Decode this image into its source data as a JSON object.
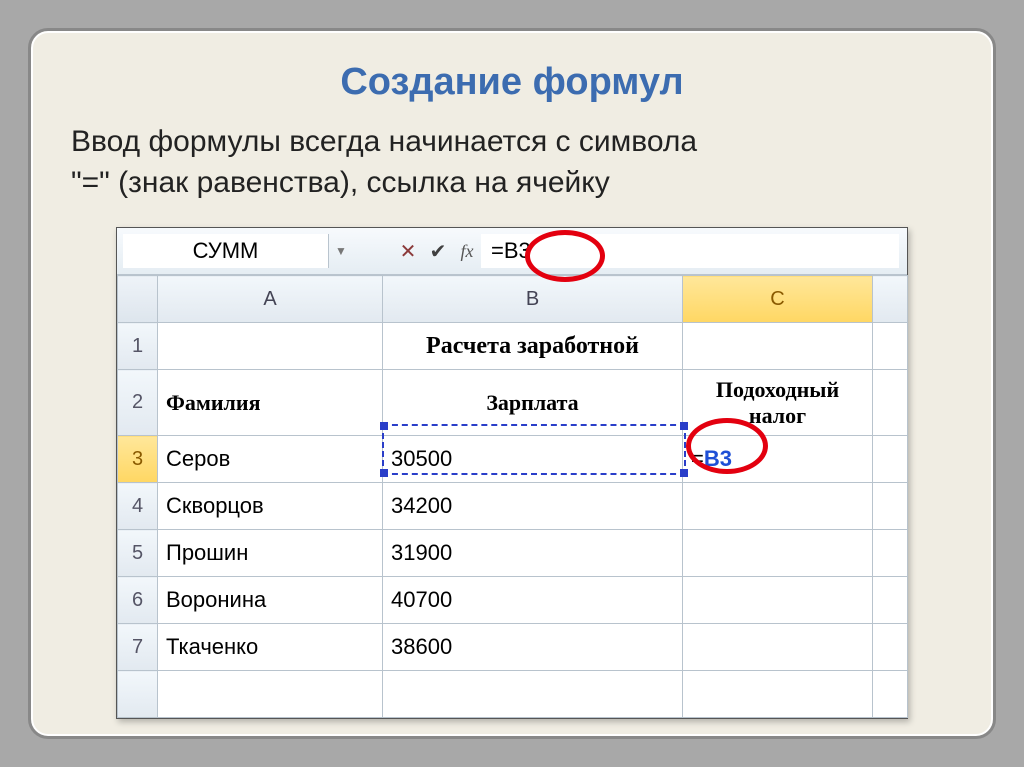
{
  "slide": {
    "title": "Создание формул",
    "text_line1": "Ввод формулы всегда начинается с символа",
    "text_line2": "\"=\" (знак равенства), ссылка на ячейку"
  },
  "formula_bar": {
    "name_box": "СУММ",
    "fx_label": "fx",
    "formula_value": "=B3"
  },
  "columns": {
    "A": "A",
    "B": "B",
    "C": "C"
  },
  "row_headers": [
    "1",
    "2",
    "3",
    "4",
    "5",
    "6",
    "7"
  ],
  "cells": {
    "B1": "Расчета заработной",
    "A2": "Фамилия",
    "B2": "Зарплата",
    "C2_line1": "Подоходный",
    "C2_line2": "налог",
    "A3": "Серов",
    "B3": "30500",
    "C3_eq": "=",
    "C3_ref": "B3",
    "A4": "Скворцов",
    "B4": "34200",
    "A5": "Прошин",
    "B5": "31900",
    "A6": "Воронина",
    "B6": "40700",
    "A7": "Ткаченко",
    "B7": "38600"
  }
}
